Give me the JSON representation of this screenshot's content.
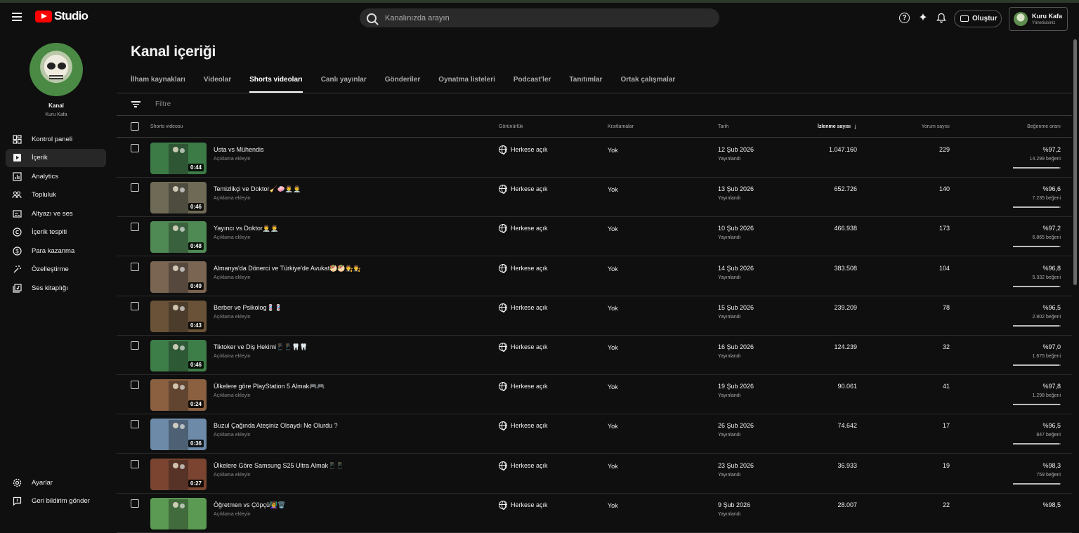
{
  "header": {
    "logo_text": "Studio",
    "search_placeholder": "Kanalınızda arayın",
    "create_label": "Oluştur",
    "account_name": "Kuru Kafa",
    "account_role": "Yöneticisiniz",
    "icons": [
      "menu-icon",
      "help-icon",
      "sparkle-icon",
      "bell-icon",
      "video-camera-icon"
    ]
  },
  "sidebar": {
    "channel_title": "Kanal",
    "channel_name": "Kuru Kafa",
    "items": [
      {
        "label": "Kontrol paneli",
        "icon": "dashboard-icon"
      },
      {
        "label": "İçerik",
        "icon": "content-icon"
      },
      {
        "label": "Analytics",
        "icon": "analytics-icon"
      },
      {
        "label": "Topluluk",
        "icon": "community-icon"
      },
      {
        "label": "Altyazı ve ses",
        "icon": "subtitles-icon"
      },
      {
        "label": "İçerik tespiti",
        "icon": "copyright-icon"
      },
      {
        "label": "Para kazanma",
        "icon": "dollar-icon"
      },
      {
        "label": "Özelleştirme",
        "icon": "magic-wand-icon"
      },
      {
        "label": "Ses kitaplığı",
        "icon": "audio-library-icon"
      }
    ],
    "bottom": [
      {
        "label": "Ayarlar",
        "icon": "gear-icon"
      },
      {
        "label": "Geri bildirim gönder",
        "icon": "feedback-icon"
      }
    ]
  },
  "main": {
    "title": "Kanal içeriği",
    "tabs": [
      "İlham kaynakları",
      "Videolar",
      "Shorts videoları",
      "Canlı yayınlar",
      "Gönderiler",
      "Oynatma listeleri",
      "Podcast'ler",
      "Tanıtımlar",
      "Ortak çalışmalar"
    ],
    "active_tab": "Shorts videoları",
    "filter_placeholder": "Filtre",
    "columns": {
      "video": "Shorts videosu",
      "visibility": "Görünürlük",
      "restrictions": "Kısıtlamalar",
      "date": "Tarih",
      "views": "İzlenme sayısı",
      "sort_arrow": "↓",
      "comments": "Yorum sayısı",
      "likes": "Beğenme oranı"
    },
    "rows": [
      {
        "title": "Usta vs Mühendis",
        "desc": "Açıklama ekleyin",
        "duration": "0:44",
        "visibility": "Herkese açık",
        "restrictions": "Yok",
        "date": "12 Şub 2026",
        "status": "Yayınlandı",
        "views": "1.047.160",
        "comments": "229",
        "like_pct": "%97,2",
        "like_count": "14.299 beğeni",
        "like_ratio": 0.972,
        "thumb_color": "#3c7a46"
      },
      {
        "title": "Temizlikçi ve Doktor🧹🧼👨‍⚕️👨‍⚕️",
        "desc": "Açıklama ekleyin",
        "duration": "0:46",
        "visibility": "Herkese açık",
        "restrictions": "Yok",
        "date": "13 Şub 2026",
        "status": "Yayınlandı",
        "views": "652.726",
        "comments": "140",
        "like_pct": "%96,6",
        "like_count": "7.235 beğeni",
        "like_ratio": 0.966,
        "thumb_color": "#6e6a55"
      },
      {
        "title": "Yayıncı vs Doktor👨‍⚕️👨‍⚕️",
        "desc": "Açıklama ekleyin",
        "duration": "0:48",
        "visibility": "Herkese açık",
        "restrictions": "Yok",
        "date": "10 Şub 2026",
        "status": "Yayınlandı",
        "views": "466.938",
        "comments": "173",
        "like_pct": "%97,2",
        "like_count": "6.865 beğeni",
        "like_ratio": 0.972,
        "thumb_color": "#4f8a55"
      },
      {
        "title": "Almanya'da Dönerci ve Türkiye'de Avukat🥙🥙👨‍⚖️👨‍⚖️",
        "desc": "Açıklama ekleyin",
        "duration": "0:49",
        "visibility": "Herkese açık",
        "restrictions": "Yok",
        "date": "14 Şub 2026",
        "status": "Yayınlandı",
        "views": "383.508",
        "comments": "104",
        "like_pct": "%96,8",
        "like_count": "5.332 beğeni",
        "like_ratio": 0.968,
        "thumb_color": "#7a6552"
      },
      {
        "title": "Berber ve Psikolog💈💈",
        "desc": "Açıklama ekleyin",
        "duration": "0:43",
        "visibility": "Herkese açık",
        "restrictions": "Yok",
        "date": "15 Şub 2026",
        "status": "Yayınlandı",
        "views": "239.209",
        "comments": "78",
        "like_pct": "%96,5",
        "like_count": "2.802 beğeni",
        "like_ratio": 0.965,
        "thumb_color": "#6a5238"
      },
      {
        "title": "Tiktoker ve Diş Hekimi📱📱🦷🦷",
        "desc": "Açıklama ekleyin",
        "duration": "0:46",
        "visibility": "Herkese açık",
        "restrictions": "Yok",
        "date": "16 Şub 2026",
        "status": "Yayınlandı",
        "views": "124.239",
        "comments": "32",
        "like_pct": "%97,0",
        "like_count": "1.675 beğeni",
        "like_ratio": 0.97,
        "thumb_color": "#3d7e48"
      },
      {
        "title": "Ülkelere göre PlayStation 5 Almak🎮🎮",
        "desc": "Açıklama ekleyin",
        "duration": "0:24",
        "visibility": "Herkese açık",
        "restrictions": "Yok",
        "date": "19 Şub 2026",
        "status": "Yayınlandı",
        "views": "90.061",
        "comments": "41",
        "like_pct": "%97,8",
        "like_count": "1.298 beğeni",
        "like_ratio": 0.978,
        "thumb_color": "#8a6040"
      },
      {
        "title": "Buzul Çağında Ateşiniz Olsaydı Ne Olurdu ?",
        "desc": "Açıklama ekleyin",
        "duration": "0:36",
        "visibility": "Herkese açık",
        "restrictions": "Yok",
        "date": "26 Şub 2026",
        "status": "Yayınlandı",
        "views": "74.642",
        "comments": "17",
        "like_pct": "%96,5",
        "like_count": "847 beğeni",
        "like_ratio": 0.965,
        "thumb_color": "#6d8aa8"
      },
      {
        "title": "Ülkelere Göre Samsung S25 Ultra Almak📱📱",
        "desc": "Açıklama ekleyin",
        "duration": "0:27",
        "visibility": "Herkese açık",
        "restrictions": "Yok",
        "date": "23 Şub 2026",
        "status": "Yayınlandı",
        "views": "36.933",
        "comments": "19",
        "like_pct": "%98,3",
        "like_count": "759 beğeni",
        "like_ratio": 0.983,
        "thumb_color": "#7a4430"
      },
      {
        "title": "Öğretmen vs Çöpçü👩‍🏫🗑️",
        "desc": "Açıklama ekleyin",
        "duration": "",
        "visibility": "Herkese açık",
        "restrictions": "Yok",
        "date": "9 Şub 2026",
        "status": "Yayınlandı",
        "views": "28.007",
        "comments": "22",
        "like_pct": "%98,5",
        "like_count": "",
        "like_ratio": 0.985,
        "thumb_color": "#5a9a52"
      }
    ]
  }
}
